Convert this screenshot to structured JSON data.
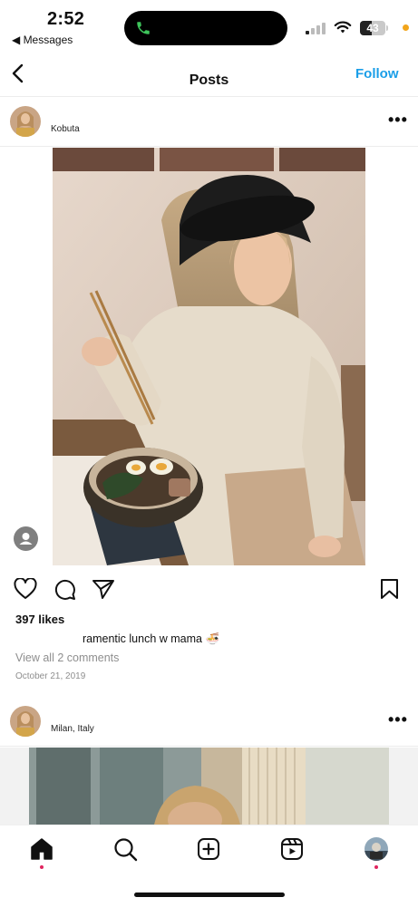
{
  "status_bar": {
    "time": "2:52",
    "back_label": "◀ Messages",
    "battery": "43",
    "call_icon": "phone-icon"
  },
  "header": {
    "title": "Posts",
    "back_icon": "chevron-left-icon",
    "follow_label": "Follow"
  },
  "post1": {
    "username": "Kobuta",
    "more_icon": "more-horizontal-icon",
    "likes": "397 likes",
    "caption": "ramentic lunch w mama 🍜",
    "view_comments": "View all 2 comments",
    "date": "October 21, 2019"
  },
  "post2": {
    "location": "Milan, Italy",
    "more_icon": "more-horizontal-icon"
  },
  "tab_bar": {
    "items": [
      "home-icon",
      "search-icon",
      "create-icon",
      "reels-icon",
      "profile-avatar"
    ]
  },
  "colors": {
    "accent": "#1a9ee8",
    "notification": "#e0245e"
  }
}
